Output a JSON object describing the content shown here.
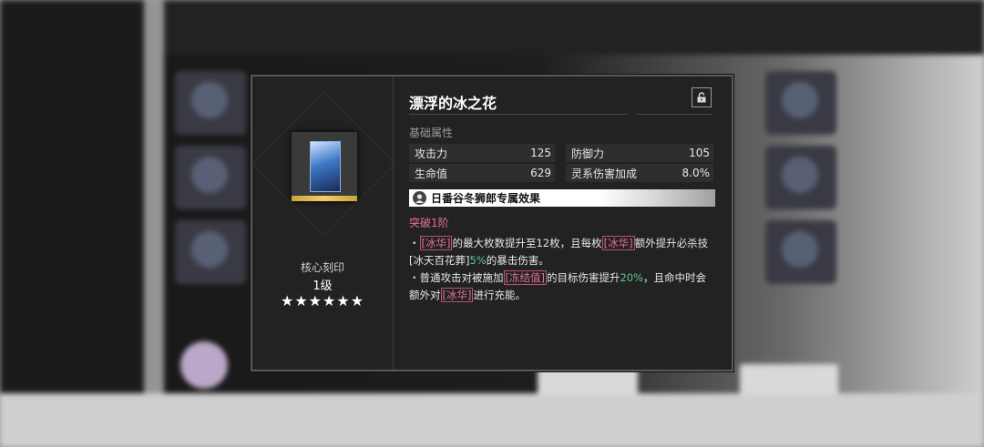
{
  "item": {
    "title": "漂浮的冰之花",
    "core_label": "核心刻印",
    "level": "1级",
    "stars": "★★★★★★"
  },
  "base_stats": {
    "label": "基础属性",
    "stats": [
      {
        "name": "攻击力",
        "value": "125"
      },
      {
        "name": "防御力",
        "value": "105"
      },
      {
        "name": "生命值",
        "value": "629"
      },
      {
        "name": "灵系伤害加成",
        "value": "8.0%"
      }
    ]
  },
  "exclusive": {
    "label": "日番谷冬狮郎专属效果"
  },
  "breakthrough": {
    "label": "突破1阶"
  },
  "effects": {
    "line1": {
      "bullet": "・",
      "kw1": "[冰华]",
      "t1": "的最大枚数提升至12枚，且每枚",
      "kw2": "[冰华]",
      "t2": "额外提升必杀技[冰天百花葬]",
      "n1": "5%",
      "t3": "的暴击伤害。"
    },
    "line2": {
      "bullet": "・",
      "t1": "普通攻击对被施加",
      "kw1": "[冻结值]",
      "t2": "的目标伤害提升",
      "n1": "20%",
      "t3": "，且命中时会额外对",
      "kw2": "[冰华]",
      "t4": "进行充能。"
    }
  },
  "icons": {
    "lock": "unlocked-lock-icon",
    "portrait": "character-portrait-icon"
  },
  "colors": {
    "keyword": "#e7709a",
    "number": "#5fc98f",
    "dialog_bg": "#222222"
  }
}
